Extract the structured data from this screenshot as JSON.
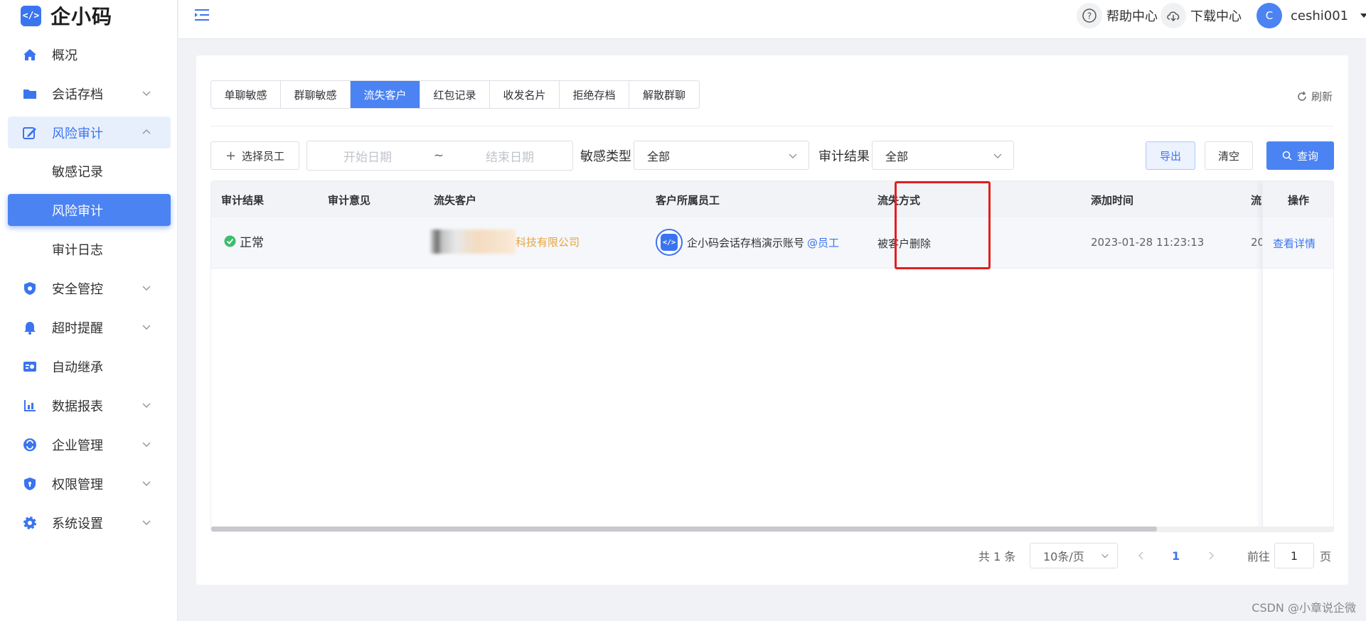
{
  "logo": {
    "mark": "</>",
    "name": "企小码"
  },
  "sidebar": {
    "items": [
      {
        "label": "概况"
      },
      {
        "label": "会话存档"
      },
      {
        "label": "风险审计"
      },
      {
        "label": "敏感记录"
      },
      {
        "label": "风险审计"
      },
      {
        "label": "审计日志"
      },
      {
        "label": "安全管控"
      },
      {
        "label": "超时提醒"
      },
      {
        "label": "自动继承"
      },
      {
        "label": "数据报表"
      },
      {
        "label": "企业管理"
      },
      {
        "label": "权限管理"
      },
      {
        "label": "系统设置"
      }
    ]
  },
  "header": {
    "help_label": "帮助中心",
    "download_label": "下载中心",
    "avatar_initial": "C",
    "username": "ceshi001"
  },
  "tabs": [
    {
      "label": "单聊敏感"
    },
    {
      "label": "群聊敏感"
    },
    {
      "label": "流失客户"
    },
    {
      "label": "红包记录"
    },
    {
      "label": "收发名片"
    },
    {
      "label": "拒绝存档"
    },
    {
      "label": "解散群聊"
    }
  ],
  "refresh_label": "刷新",
  "filters": {
    "select_staff_label": "选择员工",
    "start_date_placeholder": "开始日期",
    "range_separator": "~",
    "end_date_placeholder": "结束日期",
    "sensitive_type_label": "敏感类型",
    "sensitive_type_value": "全部",
    "audit_result_label": "审计结果",
    "audit_result_value": "全部",
    "export_label": "导出",
    "clear_label": "清空",
    "query_label": "查询"
  },
  "table": {
    "columns": [
      "审计结果",
      "审计意见",
      "流失客户",
      "客户所属员工",
      "流失方式",
      "添加时间",
      "流",
      "操作"
    ],
    "rows": [
      {
        "audit_result": "正常",
        "audit_opinion": "",
        "customer_suffix": "科技有限公司",
        "staff_name": "企小码会话存档演示账号",
        "staff_tag": "@员工",
        "loss_method": "被客户删除",
        "added_time": "2023-01-28 11:23:13",
        "lost_time_partial": "20",
        "action": "查看详情"
      }
    ]
  },
  "pagination": {
    "total_text": "共 1 条",
    "page_size": "10条/页",
    "current_page": "1",
    "goto_label": "前往",
    "goto_value": "1",
    "page_suffix": "页"
  },
  "watermark": "CSDN @小章说企微",
  "colors": {
    "primary": "#4b83f3",
    "highlight": "#e0201e",
    "customer_text": "#e8a33d",
    "success": "#3dbd6e"
  }
}
